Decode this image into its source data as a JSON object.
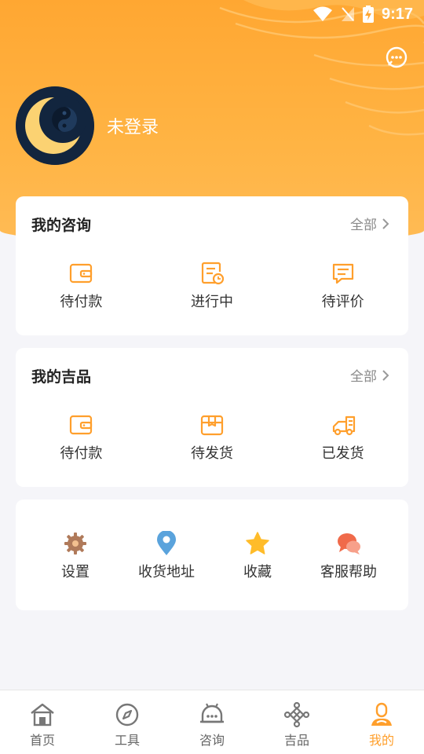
{
  "status": {
    "time": "9:17"
  },
  "profile": {
    "login_text": "未登录"
  },
  "consult_card": {
    "title": "我的咨询",
    "more": "全部",
    "items": [
      {
        "label": "待付款",
        "icon": "wallet-icon"
      },
      {
        "label": "进行中",
        "icon": "document-clock-icon"
      },
      {
        "label": "待评价",
        "icon": "comment-icon"
      }
    ]
  },
  "goods_card": {
    "title": "我的吉品",
    "more": "全部",
    "items": [
      {
        "label": "待付款",
        "icon": "wallet-icon"
      },
      {
        "label": "待发货",
        "icon": "box-icon"
      },
      {
        "label": "已发货",
        "icon": "truck-icon"
      }
    ]
  },
  "services": {
    "items": [
      {
        "label": "设置",
        "icon": "gear-icon"
      },
      {
        "label": "收货地址",
        "icon": "location-pin-icon"
      },
      {
        "label": "收藏",
        "icon": "star-icon"
      },
      {
        "label": "客服帮助",
        "icon": "chat-bubbles-icon"
      }
    ]
  },
  "tabbar": {
    "items": [
      {
        "label": "首页",
        "icon": "home-icon"
      },
      {
        "label": "工具",
        "icon": "compass-icon"
      },
      {
        "label": "咨询",
        "icon": "consult-icon"
      },
      {
        "label": "吉品",
        "icon": "knot-icon"
      },
      {
        "label": "我的",
        "icon": "user-icon",
        "active": true
      }
    ]
  },
  "colors": {
    "accent": "#ff9f2c",
    "header": "#ffa732"
  }
}
